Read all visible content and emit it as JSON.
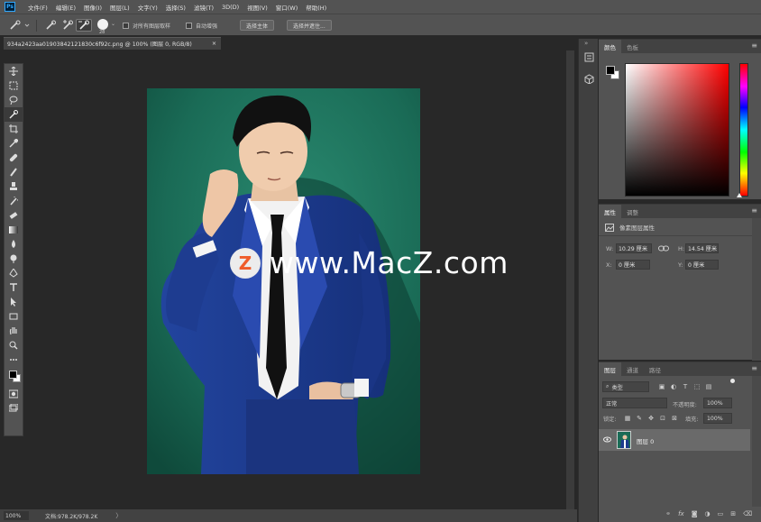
{
  "menubar": {
    "logo": "Ps",
    "items": [
      "文件(F)",
      "编辑(E)",
      "图像(I)",
      "图层(L)",
      "文字(Y)",
      "选择(S)",
      "滤镜(T)",
      "3D(D)",
      "视图(V)",
      "窗口(W)",
      "帮助(H)"
    ]
  },
  "options": {
    "brush_size": "28",
    "sample_all_layers": "对所有图层取样",
    "auto_enhance": "自动增强",
    "select_subject": "选择主体",
    "select_and_mask": "选择并遮住..."
  },
  "document": {
    "tab_title": "934a2423aa01903842121830c6f92c.png @ 100% (图层 0, RGB/8)",
    "close_glyph": "×"
  },
  "watermark": {
    "logo_letter": "Z",
    "text": "www.MacZ.com"
  },
  "status": {
    "zoom": "100%",
    "doc_size": "文档:978.2K/978.2K",
    "arrow": "〉"
  },
  "color_panel": {
    "tabs": [
      "颜色",
      "色板"
    ],
    "foreground": "#000000",
    "background": "#ffffff"
  },
  "properties_panel": {
    "tabs": [
      "属性",
      "调整"
    ],
    "layer_kind": "像素图层属性",
    "w_label": "W:",
    "w_value": "10.29 厘米",
    "h_label": "H:",
    "h_value": "14.54 厘米",
    "x_label": "X:",
    "x_value": "0 厘米",
    "y_label": "Y:",
    "y_value": "0 厘米"
  },
  "layers_panel": {
    "tabs": [
      "图层",
      "通道",
      "路径"
    ],
    "filter_kind": "类型",
    "blend_mode": "正常",
    "opacity_label": "不透明度:",
    "opacity_value": "100%",
    "lock_label": "锁定:",
    "fill_label": "填充:",
    "fill_value": "100%",
    "layer_name": "图层 0"
  },
  "colors": {
    "ui_dark": "#282828",
    "ui_panel": "#535353",
    "accent": "#31a8ff",
    "photo_bg": "#1a6b56",
    "suit": "#1c3a8e"
  }
}
